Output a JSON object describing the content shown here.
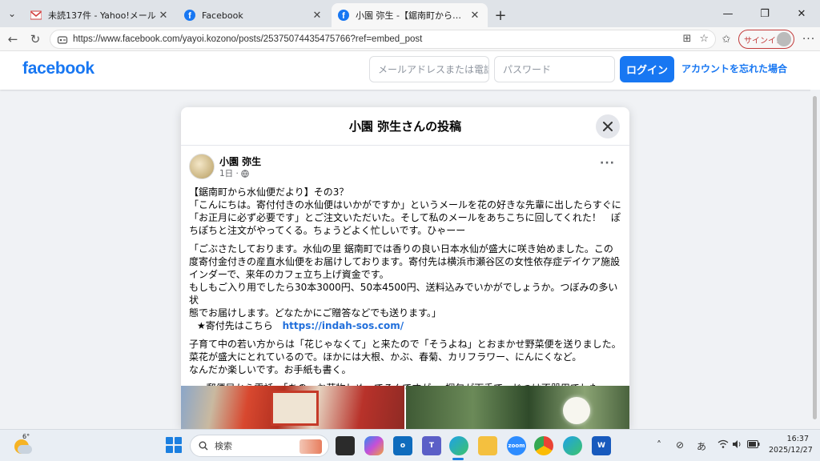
{
  "browser": {
    "tabs": [
      {
        "title": "未読137件 - Yahoo!メール",
        "icon": "yahoo-mail-icon",
        "active": false
      },
      {
        "title": "Facebook",
        "icon": "facebook-icon",
        "active": false
      },
      {
        "title": "小園 弥生 -【鋸南町から水仙便だよ",
        "icon": "facebook-icon",
        "active": true
      }
    ],
    "url": "https://www.facebook.com/yayoi.kozono/posts/25375074435475766?ref=embed_post",
    "signin_label": "サインイン"
  },
  "fb_header": {
    "logo": "facebook",
    "email_placeholder": "メールアドレスまたは電話番号",
    "password_placeholder": "パスワード",
    "login_label": "ログイン",
    "forgot_label": "アカウントを忘れた場合"
  },
  "dialog": {
    "title": "小園 弥生さんの投稿",
    "author": "小園 弥生",
    "time": "1日 ·",
    "paragraphs": [
      [
        "【鋸南町から水仙便だより】その3？",
        "「こんにちは。寄付付きの水仙便はいかがですか」というメールを花の好きな先輩に出したらすぐに",
        "「お正月に必ず必要です」とご注文いただいた。そして私のメールをあちこちに回してくれた！　ぽ",
        "ちぽちと注文がやってくる。ちょうどよく忙しいです。ひゃーー"
      ],
      [
        "「ごぶさたしております。水仙の里 鋸南町では香りの良い日本水仙が盛大に咲き始めました。この",
        "度寄付金付きの産直水仙便をお届けしております。寄付先は横浜市瀬谷区の女性依存症デイケア施設",
        "インダーで、来年のカフェ立ち上げ資金です。",
        "もしもご入り用でしたら30本3000円、50本4500円、送料込みでいかがでしょうか。つぼみの多い状",
        "態でお届けします。どなたかにご贈答などでも送ります。」"
      ],
      [
        "子育て中の若い方からは「花じゃなくて」と来たので「そうよね」とおまかせ野菜便を送りました。",
        "菜花が盛大にとれているので。ほかには大根、かぶ、春菊、カリフラワー、にんにくなど。",
        "なんだか楽しいです。お手紙も書く。"
      ],
      [
        "p.s 郵便局から電話。「あの、お荷物しめってるんですが」。梱包が下手で。じつは不器用でした。"
      ]
    ],
    "donation_label": "★寄付先はこちら",
    "donation_link": "https://indah-sos.com/"
  },
  "taskbar": {
    "temperature": "6°",
    "search_label": "検索",
    "time": "16:37",
    "date": "2025/12/27",
    "ime": "あ"
  }
}
